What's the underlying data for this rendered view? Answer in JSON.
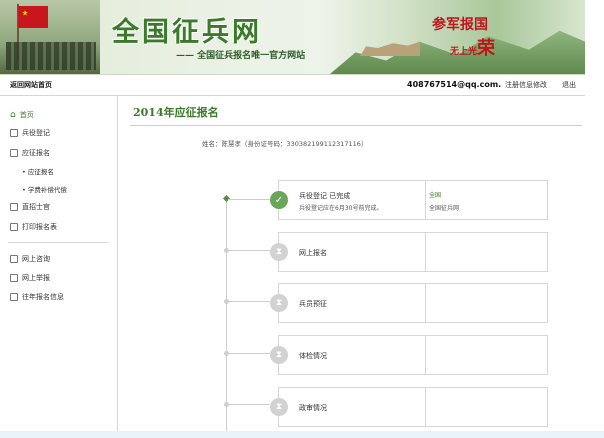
{
  "banner": {
    "title": "全国征兵网",
    "subtitle": "—— 全国征兵报名唯一官方网站",
    "slogan_line1": "参军报国",
    "slogan_line2": "无上光",
    "slogan_big": "荣"
  },
  "topbar": {
    "home_link": "返回网站首页",
    "email": "408767514@qq.com.",
    "edit_info": "注册信息修改",
    "logout": "退出"
  },
  "sidebar": {
    "items": [
      {
        "label": "首页",
        "icon": "home-icon"
      },
      {
        "label": "兵役登记",
        "icon": "document-icon"
      },
      {
        "label": "应征报名",
        "icon": "form-icon"
      },
      {
        "label": "应征报名",
        "icon": "bullet"
      },
      {
        "label": "学费补偿代偿",
        "icon": "bullet"
      },
      {
        "label": "直招士官",
        "icon": "badge-icon"
      },
      {
        "label": "打印报名表",
        "icon": "print-icon"
      },
      {
        "label": "网上咨询",
        "icon": "chat-icon"
      },
      {
        "label": "网上举报",
        "icon": "mail-icon"
      },
      {
        "label": "往年报名信息",
        "icon": "history-icon"
      }
    ]
  },
  "main": {
    "title": "2014年应征报名",
    "user_info": "姓名：陈慧孝（身份证号码：330382199112317116）"
  },
  "steps": [
    {
      "label": "兵役登记 已完成",
      "desc": "兵役登记应在6月30号前完成。",
      "right1": "全国",
      "right2": "全国征兵网",
      "status": "done"
    },
    {
      "label": "网上报名",
      "desc": "",
      "right1": "",
      "right2": "",
      "status": "pending"
    },
    {
      "label": "兵员预征",
      "desc": "",
      "right1": "",
      "right2": "",
      "status": "pending"
    },
    {
      "label": "体检情况",
      "desc": "",
      "right1": "",
      "right2": "",
      "status": "pending"
    },
    {
      "label": "政审情况",
      "desc": "",
      "right1": "",
      "right2": "",
      "status": "pending"
    }
  ],
  "colors": {
    "accent": "#3a7a2a",
    "done": "#6aa55a",
    "pending": "#d2d2d2"
  }
}
